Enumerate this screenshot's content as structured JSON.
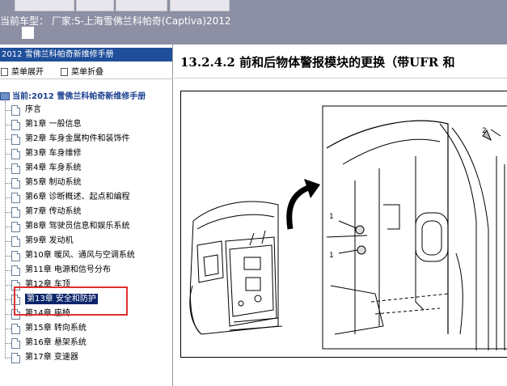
{
  "header": {
    "title": "当前车型：  厂家:S-上海雪佛兰科帕奇(Captiva)2012"
  },
  "manual": {
    "title": "2012 雪佛兰科帕奇新维修手册"
  },
  "toolbar": {
    "expand": "菜单展开",
    "collapse": "菜单折叠"
  },
  "tree": {
    "root": "当前:2012 雪佛兰科帕奇新维修手册",
    "items": [
      "序言",
      "第1章 一般信息",
      "第2章 车身金属构件和装饰件",
      "第3章 车身维修",
      "第4章 车身系统",
      "第5章 制动系统",
      "第6章 诊断概述、起点和编程",
      "第7章 传动系统",
      "第8章 驾驶员信息和娱乐系统",
      "第9章 发动机",
      "第10章 暖风、通风与空调系统",
      "第11章 电源和信号分布",
      "第12章 车顶",
      "第13章 安全和防护",
      "第14章 座椅",
      "第15章 转向系统",
      "第16章 悬架系统",
      "第17章 变速器"
    ],
    "selected_index": 13
  },
  "main": {
    "heading": "13.2.4.2 前和后物体警报模块的更换（带UFR 和"
  },
  "figure": {
    "callout_1a": "1",
    "callout_1b": "1",
    "callout_2": "2"
  },
  "colors": {
    "topbar": "#8d8fa4",
    "header_bg": "#1f4f9a",
    "selected": "#0a246a",
    "highlight_box": "#e03030"
  }
}
